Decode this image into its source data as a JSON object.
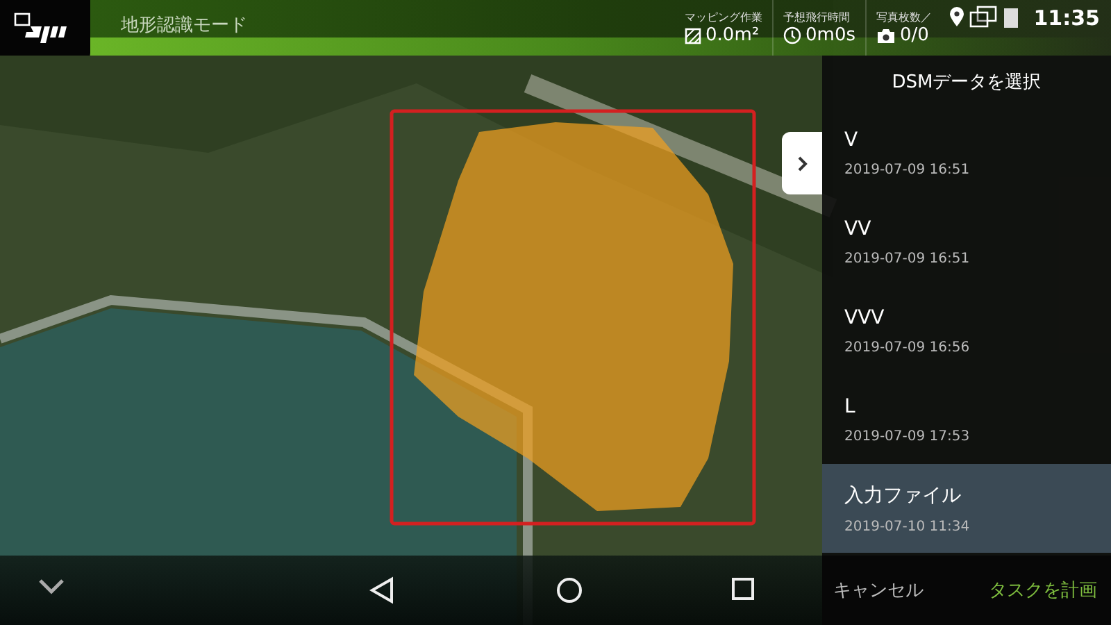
{
  "header": {
    "mode_title": "地形認識モード"
  },
  "stats": [
    {
      "kind": "area",
      "label": "マッピング作業",
      "value": "0.0m²"
    },
    {
      "kind": "time",
      "label": "予想飛行時間",
      "value": "0m0s"
    },
    {
      "kind": "photos",
      "label": "写真枚数／",
      "value": "0/0"
    }
  ],
  "status_bar": {
    "time": "11:35"
  },
  "panel": {
    "title": "DSMデータを選択",
    "items": [
      {
        "name": "V",
        "date": "2019-07-09 16:51",
        "selected": false
      },
      {
        "name": "VV",
        "date": "2019-07-09 16:51",
        "selected": false
      },
      {
        "name": "VVV",
        "date": "2019-07-09 16:56",
        "selected": false
      },
      {
        "name": "L",
        "date": "2019-07-09 17:53",
        "selected": false
      },
      {
        "name": "入力ファイル",
        "date": "2019-07-10 11:34",
        "selected": true
      }
    ],
    "cancel": "キャンセル",
    "confirm": "タスクを計画"
  }
}
